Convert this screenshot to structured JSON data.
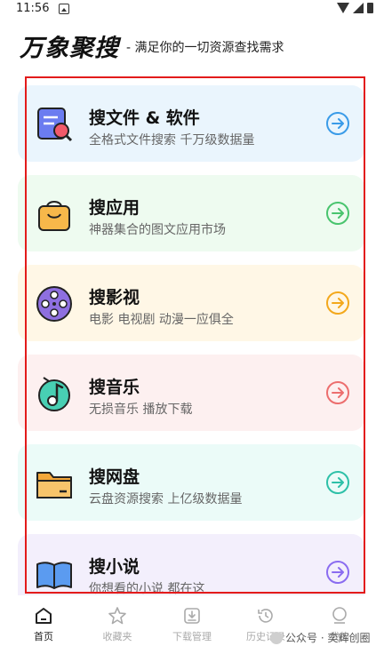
{
  "status_bar": {
    "time": "11:56"
  },
  "header": {
    "logo": "万象聚搜",
    "slogan": "- 满足你的一切资源查找需求"
  },
  "cards": [
    {
      "title": "搜文件 & 软件",
      "subtitle": "全格式文件搜索 千万级数据量",
      "bg": "#eaf5fd",
      "accent": "#3a9be8",
      "icon": "file-search-icon"
    },
    {
      "title": "搜应用",
      "subtitle": "神器集合的图文应用市场",
      "bg": "#eefbf0",
      "accent": "#49c46e",
      "icon": "shopping-bag-icon"
    },
    {
      "title": "搜影视",
      "subtitle": "电影 电视剧 动漫一应俱全",
      "bg": "#fff7e6",
      "accent": "#f3a81c",
      "icon": "film-reel-icon"
    },
    {
      "title": "搜音乐",
      "subtitle": "无损音乐 播放下载",
      "bg": "#fdf0f0",
      "accent": "#ec6e6e",
      "icon": "music-note-icon"
    },
    {
      "title": "搜网盘",
      "subtitle": "云盘资源搜索 上亿级数据量",
      "bg": "#ebfbf8",
      "accent": "#2ec0a8",
      "icon": "folder-icon"
    },
    {
      "title": "搜小说",
      "subtitle": "你想看的小说 都在这",
      "bg": "#f3effc",
      "accent": "#8a6cf0",
      "icon": "book-icon"
    }
  ],
  "tabs": [
    {
      "label": "首页",
      "icon": "home-icon",
      "active": true
    },
    {
      "label": "收藏夹",
      "icon": "star-icon",
      "active": false
    },
    {
      "label": "下载管理",
      "icon": "download-icon",
      "active": false
    },
    {
      "label": "历史记录",
      "icon": "history-icon",
      "active": false
    },
    {
      "label": "我的",
      "icon": "user-icon",
      "active": false
    }
  ],
  "watermark": "公众号 · 奕辉创圈"
}
